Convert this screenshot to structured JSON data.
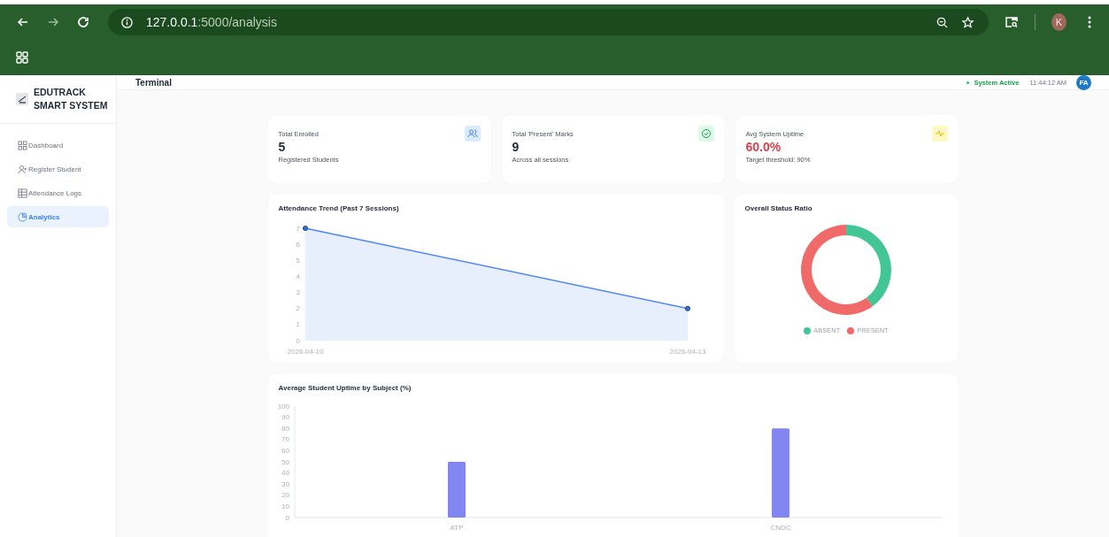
{
  "browser": {
    "url_host": "127.0.0.1",
    "url_path": ":5000/analysis",
    "profile_initial": "K"
  },
  "sidebar": {
    "brand": [
      "EDUTRACK",
      "SMART SYSTEM"
    ],
    "items": [
      {
        "label": "Dashboard",
        "selected": false
      },
      {
        "label": "Register Student",
        "selected": false
      },
      {
        "label": "Attendance Logs",
        "selected": false
      },
      {
        "label": "Analytics",
        "selected": true
      }
    ]
  },
  "header": {
    "title": "Terminal",
    "status": "System Active",
    "time": "11:44:12 AM",
    "user_initials": "FA"
  },
  "stats": [
    {
      "label": "Total Enrolled",
      "value": "5",
      "caption": "Registered Students",
      "alert": false
    },
    {
      "label": "Total 'Present' Marks",
      "value": "9",
      "caption": "Across all sessions",
      "alert": false
    },
    {
      "label": "Avg System Uptime",
      "value": "60.0%",
      "caption": "Target threshold: 90%",
      "alert": true
    }
  ],
  "trend": {
    "chart_data": {
      "type": "area",
      "title": "Attendance Trend (Past 7 Sessions)",
      "x": [
        "2026-04-10",
        "2026-04-13"
      ],
      "series": [
        {
          "color": "#4f86f7",
          "values": [
            7,
            2
          ]
        }
      ],
      "ylim": [
        0,
        7
      ],
      "yticks": [
        0,
        1,
        2,
        3,
        4,
        5,
        6,
        7
      ]
    }
  },
  "ratio": {
    "chart_data": {
      "type": "donut",
      "title": "Overall Status Ratio",
      "categories": [
        "ABSENT",
        "PRESENT"
      ],
      "series": [
        {
          "values": [
            40,
            60
          ]
        }
      ],
      "colors": [
        "#43c695",
        "#f06a6a"
      ]
    }
  },
  "uptime": {
    "chart_data": {
      "type": "bar",
      "title": "Average Student Uptime by Subject (%)",
      "categories": [
        "ATP",
        "CNDC"
      ],
      "series": [
        {
          "color": "#8286f0",
          "values": [
            50,
            80
          ]
        }
      ],
      "ylim": [
        0,
        100
      ],
      "yticks": [
        0,
        10,
        20,
        30,
        40,
        50,
        60,
        70,
        80,
        90,
        100
      ]
    }
  }
}
